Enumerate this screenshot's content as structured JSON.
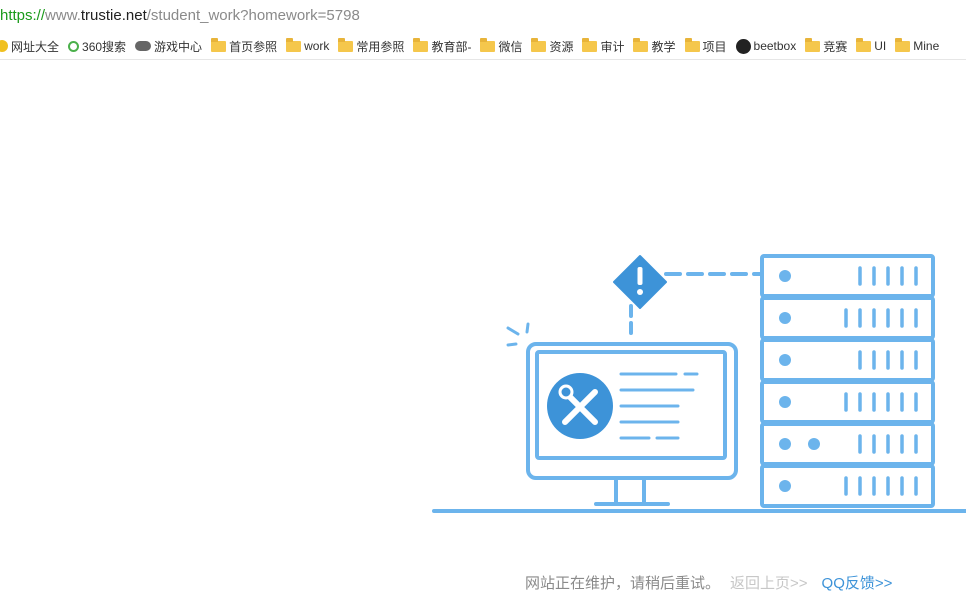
{
  "url": {
    "scheme": "https://",
    "host_prefix": "www.",
    "host": "trustie.net",
    "path": "/student_work?homework=5798"
  },
  "bookmarks": [
    {
      "label": "网址大全",
      "icon": "smile-icon"
    },
    {
      "label": "360搜索",
      "icon": "search-360-icon"
    },
    {
      "label": "游戏中心",
      "icon": "gamepad-icon"
    },
    {
      "label": "首页参照",
      "icon": "folder-icon"
    },
    {
      "label": "work",
      "icon": "folder-icon"
    },
    {
      "label": "常用参照",
      "icon": "folder-icon"
    },
    {
      "label": "教育部-",
      "icon": "folder-icon"
    },
    {
      "label": "微信",
      "icon": "folder-icon"
    },
    {
      "label": "资源",
      "icon": "folder-icon"
    },
    {
      "label": "审计",
      "icon": "folder-icon"
    },
    {
      "label": "教学",
      "icon": "folder-icon"
    },
    {
      "label": "项目",
      "icon": "folder-icon"
    },
    {
      "label": "beetbox",
      "icon": "github-icon"
    },
    {
      "label": "竞赛",
      "icon": "folder-icon"
    },
    {
      "label": "UI",
      "icon": "folder-icon"
    },
    {
      "label": "Mine",
      "icon": "folder-icon"
    }
  ],
  "footer": {
    "message": "网站正在维护，请稍后重试。",
    "back_link": "返回上页>>",
    "qq_link": "QQ反馈>>"
  },
  "colors": {
    "illustration": "#6cb4ec",
    "accent": "#3d93d8",
    "url_scheme": "#1a9a1a"
  }
}
